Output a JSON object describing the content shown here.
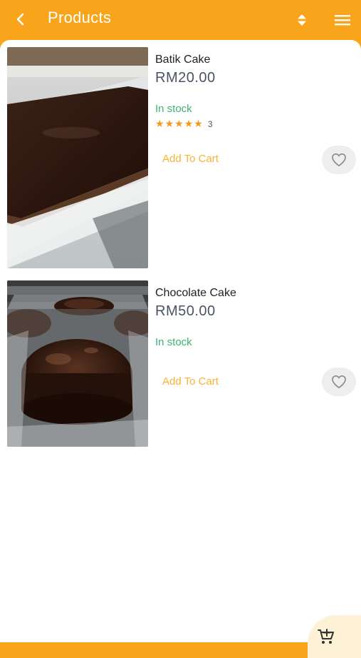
{
  "header": {
    "title": "Products",
    "back_icon": "chevron-left-icon",
    "sort_icon": "sort-icon",
    "menu_icon": "menu-icon"
  },
  "products": [
    {
      "name": "Batik Cake",
      "price": "RM20.00",
      "stock": "In stock",
      "rating": 5,
      "rating_count": "3",
      "add_to_cart": "Add To Cart"
    },
    {
      "name": "Chocolate Cake",
      "price": "RM50.00",
      "stock": "In stock",
      "add_to_cart": "Add To Cart"
    }
  ],
  "fab": {
    "icon": "add-shopping-cart-icon"
  },
  "colors": {
    "accent": "#f9a51b",
    "price": "#4a5366",
    "in_stock": "#3cb371",
    "star": "#f39a1c",
    "add_to_cart": "#f9b233"
  }
}
